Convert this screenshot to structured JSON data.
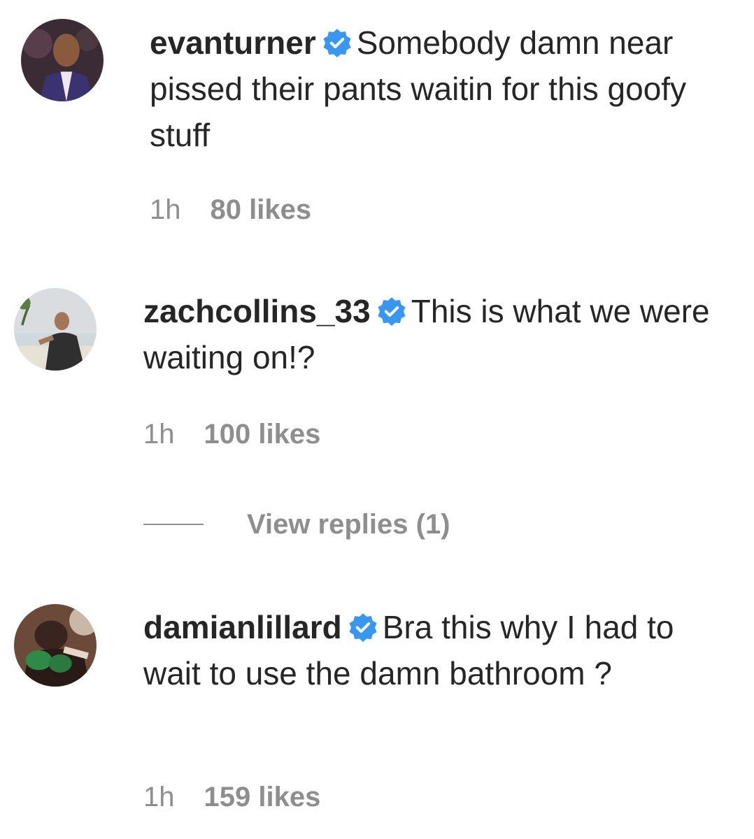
{
  "comments": [
    {
      "username": "evanturner",
      "text": "Somebody damn near pissed their pants waitin for this goofy stuff",
      "time": "1h",
      "likes": "80 likes"
    },
    {
      "username": "zachcollins_33",
      "text": "This is what we were waiting on!?",
      "time": "1h",
      "likes": "100 likes"
    },
    {
      "username": "damianlillard",
      "text": "Bra this why I had to wait to use the damn bathroom ?",
      "time": "1h",
      "likes": "159 likes"
    }
  ],
  "view_replies": "View replies (1)",
  "colors": {
    "verified_blue": "#3897f0",
    "meta_gray": "#8e8e8e",
    "text": "#262626"
  }
}
